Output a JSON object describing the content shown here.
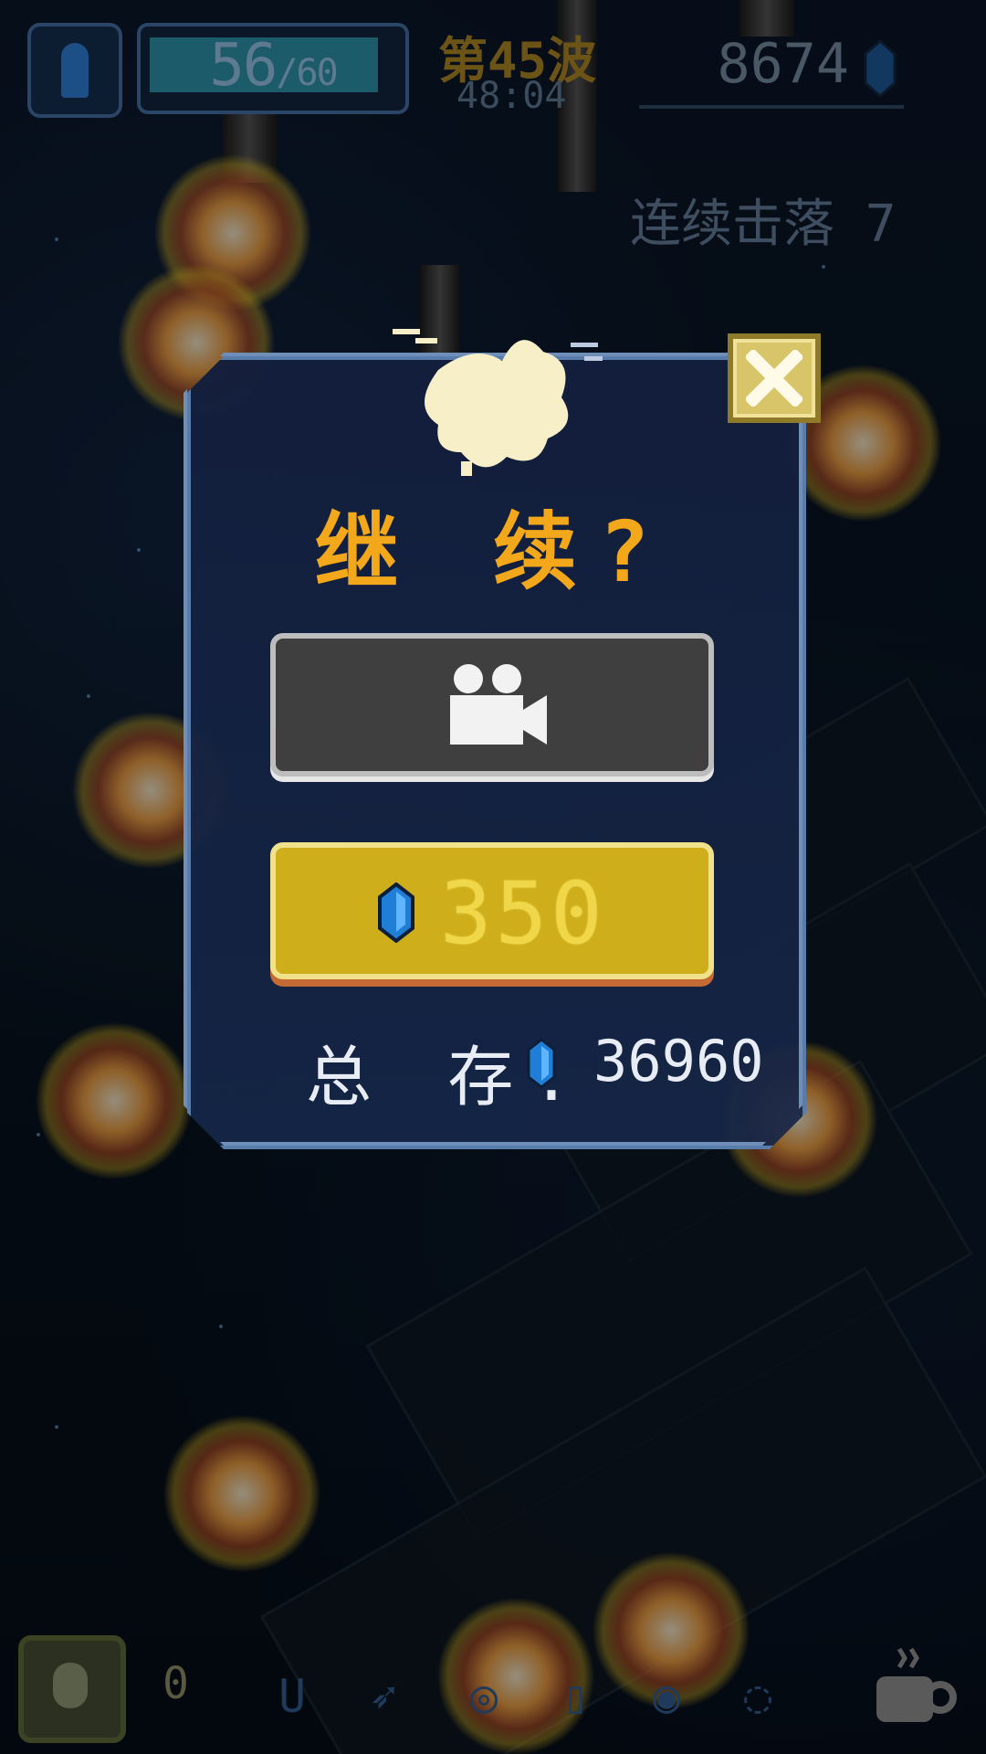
{
  "hud": {
    "hp_current": "56",
    "hp_max": "/60",
    "wave_label": "第45波",
    "timer": "48:04",
    "gem_count": "8674",
    "combo_text": "连续击落 7"
  },
  "dialog": {
    "title": "继 续?",
    "gem_price": "350",
    "total_label": "总 存:",
    "total_gems": "36960"
  },
  "bottom": {
    "bomb_count": "0"
  },
  "colors": {
    "title": "#f2a81a",
    "gem_button": "#cfae1c",
    "video_button": "#3f3f3f",
    "gem_blue": "#1f7fd6"
  },
  "icons": {
    "video": "video-camera-icon",
    "gem": "blue-gem-icon",
    "close": "close-x-icon",
    "coffee": "coffee-cup-icon",
    "magnet": "magnet-icon"
  }
}
